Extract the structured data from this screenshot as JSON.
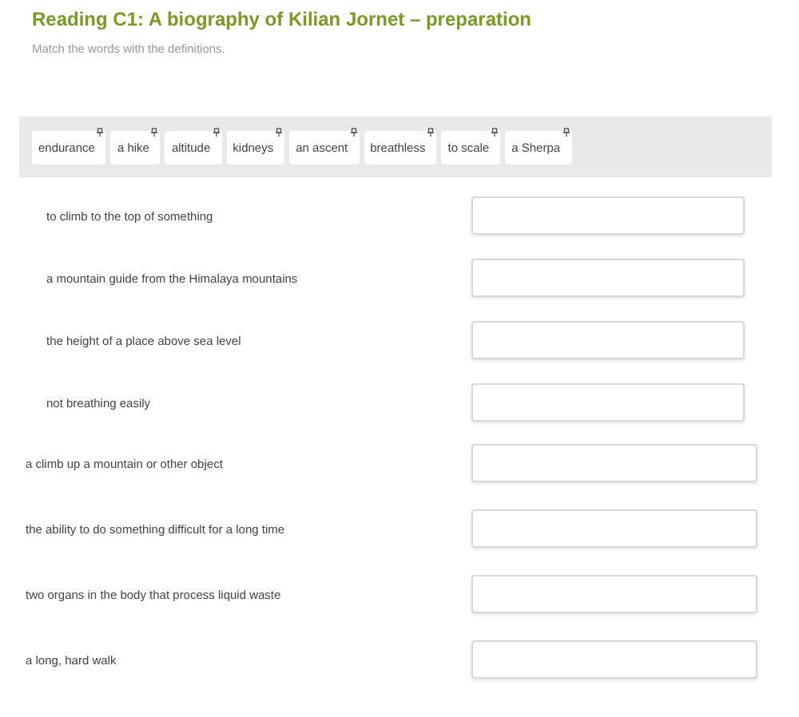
{
  "title": "Reading C1: A biography of Kilian Jornet – preparation",
  "instructions": "Match the words with the definitions.",
  "word_bank": [
    "endurance",
    "a hike",
    "altitude",
    "kidneys",
    "an ascent",
    "breathless",
    "to scale",
    "a Sherpa"
  ],
  "sections": [
    {
      "kind": "indented",
      "items": [
        "to climb to the top of something",
        "a mountain guide from the Himalaya mountains",
        "the height of a place above sea level",
        "not breathing easily"
      ]
    },
    {
      "kind": "plain",
      "items": [
        "a climb up a mountain or other object",
        "the ability to do something difficult for a long time",
        "two organs in the body that process liquid waste",
        "a long, hard walk"
      ]
    }
  ]
}
